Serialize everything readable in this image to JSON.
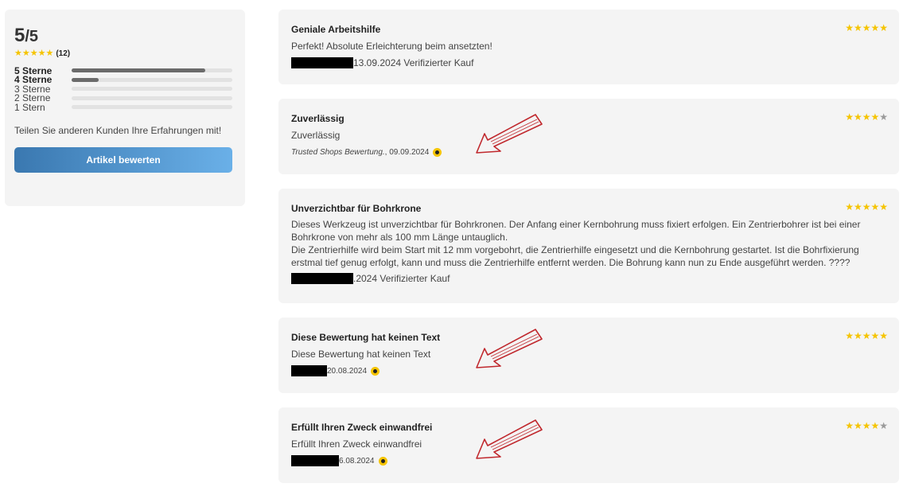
{
  "summary": {
    "score": "5",
    "score_den": "/5",
    "stars": "★★★★★",
    "count": "(12)",
    "distribution": [
      {
        "label": "5 Sterne",
        "fraction": 0.83
      },
      {
        "label": "4 Sterne",
        "fraction": 0.17
      },
      {
        "label": "3 Sterne",
        "fraction": 0
      },
      {
        "label": "2 Sterne",
        "fraction": 0
      },
      {
        "label": "1 Stern",
        "fraction": 0
      }
    ],
    "share_text": "Teilen Sie anderen Kunden Ihre Erfahrungen mit!",
    "button_label": "Artikel bewerten"
  },
  "reviews": [
    {
      "title": "Geniale Arbeitshilfe",
      "stars_on": "★★★★★",
      "stars_off": "",
      "text": "Perfekt! Absolute Erleichterung beim ansetzten!",
      "meta": "13.09.2024 Verifizierter Kauf"
    },
    {
      "title": "Zuverlässig",
      "stars_on": "★★★★",
      "stars_off": "★",
      "text": "Zuverlässig",
      "meta_italic": "Trusted Shops Bewertung.",
      "meta": ", 09.09.2024"
    },
    {
      "title": "Unverzichtbar für Bohrkrone",
      "stars_on": "★★★★★",
      "stars_off": "",
      "text_lines": [
        "Dieses Werkzeug ist unverzichtbar für Bohrkronen. Der Anfang einer Kernbohrung muss fixiert erfolgen. Ein Zentrierbohrer ist bei einer",
        "Bohrkrone von mehr als 100 mm Länge untauglich.",
        "Die Zentrierhilfe wird beim Start mit 12 mm vorgebohrt, die Zentrierhilfe eingesetzt und die Kernbohrung gestartet. Ist die Bohrfixierung",
        "erstmal tief genug erfolgt, kann und muss die Zentrierhilfe entfernt werden. Die Bohrung kann nun zu Ende ausgeführt werden. ????"
      ],
      "meta": ".2024 Verifizierter Kauf"
    },
    {
      "title": "Diese Bewertung hat keinen Text",
      "stars_on": "★★★★★",
      "stars_off": "",
      "text": "Diese Bewertung hat keinen Text",
      "meta": "20.08.2024"
    },
    {
      "title": "Erfüllt Ihren Zweck einwandfrei",
      "stars_on": "★★★★",
      "stars_off": "★",
      "text": "Erfüllt Ihren Zweck einwandfrei",
      "meta": "6.08.2024"
    }
  ],
  "colors": {
    "star": "#f5c400",
    "star_off": "#9a9a9a",
    "button_start": "#3a78b0",
    "button_end": "#6ab0e8",
    "arrow": "#c0282d",
    "card_bg": "#f4f4f4"
  },
  "icons": [
    "star-icon",
    "trusted-shops-badge-icon",
    "annotation-arrow"
  ]
}
